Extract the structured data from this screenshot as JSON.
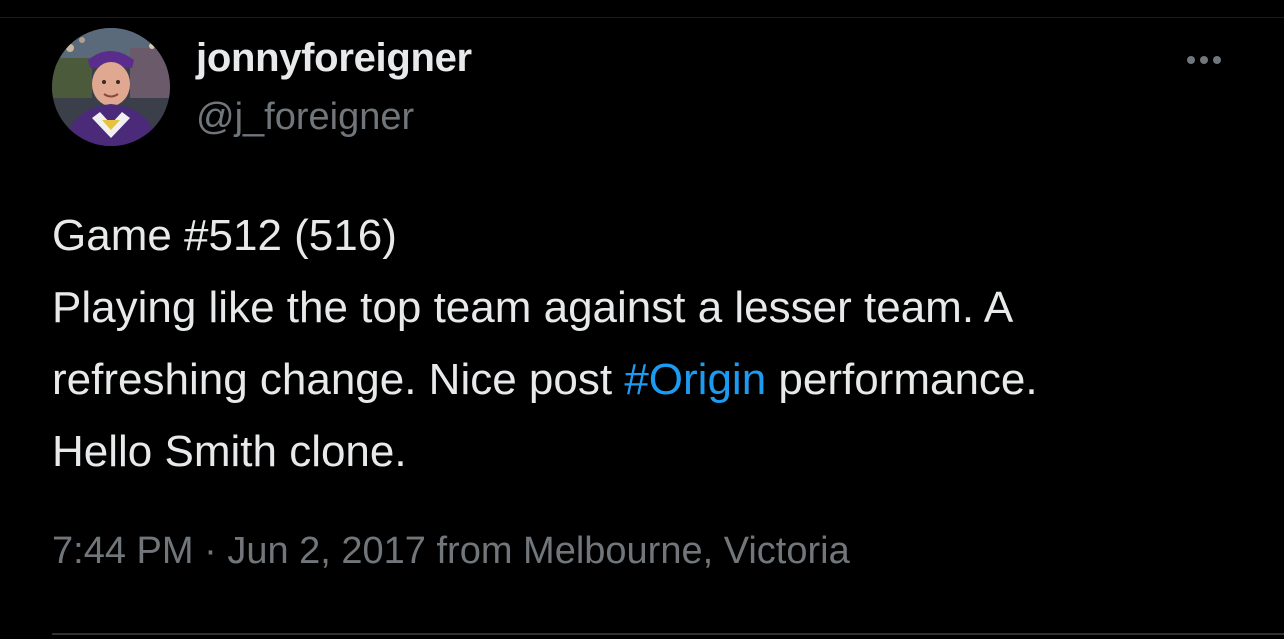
{
  "author": {
    "display_name": "jonnyforeigner",
    "handle": "@j_foreigner"
  },
  "tweet": {
    "line1": "Game #512 (516)",
    "line2": "Playing like the top team against a lesser team. A",
    "line3_before": "refreshing change. Nice post ",
    "hashtag": "#Origin",
    "line3_after": " performance.",
    "line4": "Hello Smith clone."
  },
  "meta": {
    "time": "7:44 PM",
    "separator": " · ",
    "date": "Jun 2, 2017",
    "location": " from Melbourne, Victoria"
  },
  "icons": {
    "more": "more-horizontal-icon",
    "avatar": "profile-photo"
  },
  "colors": {
    "background": "#000000",
    "text_primary": "#e7e9ea",
    "text_secondary": "#71767b",
    "link": "#1d9bf0",
    "divider": "#2f3336"
  }
}
